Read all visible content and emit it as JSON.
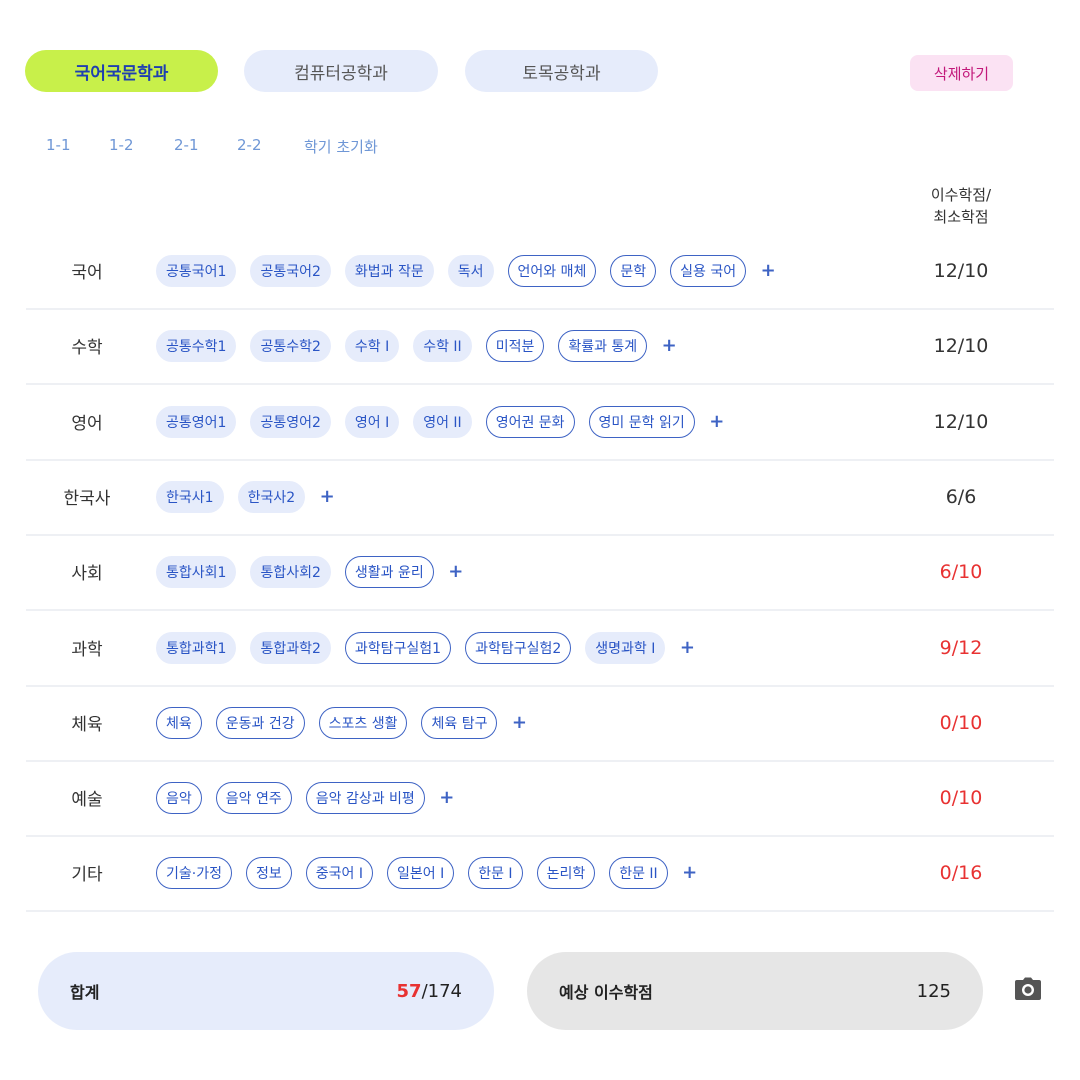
{
  "departments": [
    {
      "label": "국어국문학과",
      "active": true
    },
    {
      "label": "컴퓨터공학과",
      "active": false
    },
    {
      "label": "토목공학과",
      "active": false
    }
  ],
  "delete_label": "삭제하기",
  "semesters": [
    "1-1",
    "1-2",
    "2-1",
    "2-2"
  ],
  "reset_label": "학기 초기화",
  "credit_header": "이수학점/\n최소학점",
  "subjects": [
    {
      "name": "국어",
      "credits": "12/10",
      "warn": false,
      "courses": [
        {
          "label": "공통국어1",
          "style": "filled"
        },
        {
          "label": "공통국어2",
          "style": "filled"
        },
        {
          "label": "화법과 작문",
          "style": "filled"
        },
        {
          "label": "독서",
          "style": "filled"
        },
        {
          "label": "언어와 매체",
          "style": "outlined"
        },
        {
          "label": "문학",
          "style": "outlined"
        },
        {
          "label": "실용 국어",
          "style": "outlined"
        }
      ]
    },
    {
      "name": "수학",
      "credits": "12/10",
      "warn": false,
      "courses": [
        {
          "label": "공통수학1",
          "style": "filled"
        },
        {
          "label": "공통수학2",
          "style": "filled"
        },
        {
          "label": "수학 I",
          "style": "filled"
        },
        {
          "label": "수학 II",
          "style": "filled"
        },
        {
          "label": "미적분",
          "style": "outlined"
        },
        {
          "label": "확률과 통계",
          "style": "outlined"
        }
      ]
    },
    {
      "name": "영어",
      "credits": "12/10",
      "warn": false,
      "courses": [
        {
          "label": "공통영어1",
          "style": "filled"
        },
        {
          "label": "공통영어2",
          "style": "filled"
        },
        {
          "label": "영어 I",
          "style": "filled"
        },
        {
          "label": "영어 II",
          "style": "filled"
        },
        {
          "label": "영어권 문화",
          "style": "outlined"
        },
        {
          "label": "영미 문학 읽기",
          "style": "outlined"
        }
      ]
    },
    {
      "name": "한국사",
      "credits": "6/6",
      "warn": false,
      "courses": [
        {
          "label": "한국사1",
          "style": "filled"
        },
        {
          "label": "한국사2",
          "style": "filled"
        }
      ]
    },
    {
      "name": "사회",
      "credits": "6/10",
      "warn": true,
      "courses": [
        {
          "label": "통합사회1",
          "style": "filled"
        },
        {
          "label": "통합사회2",
          "style": "filled"
        },
        {
          "label": "생활과 윤리",
          "style": "outlined"
        }
      ]
    },
    {
      "name": "과학",
      "credits": "9/12",
      "warn": true,
      "courses": [
        {
          "label": "통합과학1",
          "style": "filled"
        },
        {
          "label": "통합과학2",
          "style": "filled"
        },
        {
          "label": "과학탐구실험1",
          "style": "outlined"
        },
        {
          "label": "과학탐구실험2",
          "style": "outlined"
        },
        {
          "label": "생명과학 I",
          "style": "filled"
        }
      ]
    },
    {
      "name": "체육",
      "credits": "0/10",
      "warn": true,
      "courses": [
        {
          "label": "체육",
          "style": "outlined"
        },
        {
          "label": "운동과 건강",
          "style": "outlined"
        },
        {
          "label": "스포츠 생활",
          "style": "outlined"
        },
        {
          "label": "체육 탐구",
          "style": "outlined"
        }
      ]
    },
    {
      "name": "예술",
      "credits": "0/10",
      "warn": true,
      "courses": [
        {
          "label": "음악",
          "style": "outlined"
        },
        {
          "label": "음악 연주",
          "style": "outlined"
        },
        {
          "label": "음악 감상과 비평",
          "style": "outlined"
        }
      ]
    },
    {
      "name": "기타",
      "credits": "0/16",
      "warn": true,
      "courses": [
        {
          "label": "기술·가정",
          "style": "outlined"
        },
        {
          "label": "정보",
          "style": "outlined"
        },
        {
          "label": "중국어 I",
          "style": "outlined"
        },
        {
          "label": "일본어 I",
          "style": "outlined"
        },
        {
          "label": "한문 I",
          "style": "outlined"
        },
        {
          "label": "논리학",
          "style": "outlined"
        },
        {
          "label": "한문 II",
          "style": "outlined"
        }
      ]
    }
  ],
  "add_label": "+",
  "total": {
    "label": "합계",
    "earned": "57",
    "separator": "/",
    "required": "174"
  },
  "expected": {
    "label": "예상 이수학점",
    "value": "125"
  },
  "icons": {
    "camera": "camera-icon"
  },
  "colors": {
    "accent": "#c8f04a",
    "chip_bg": "#e6ecfb",
    "chip_text": "#2a55c5",
    "warn": "#e83232",
    "delete_bg": "#fbe2f3"
  }
}
